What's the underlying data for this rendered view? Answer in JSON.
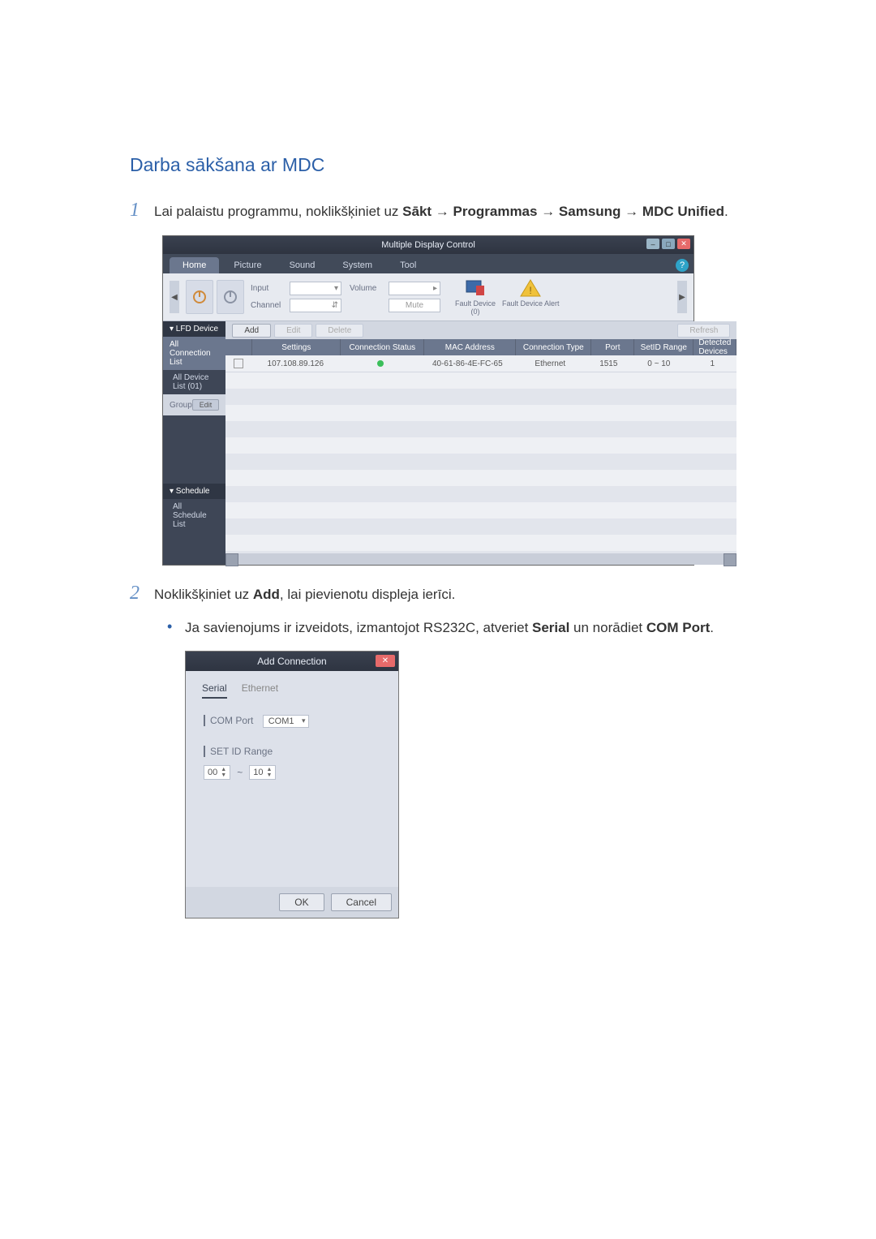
{
  "heading": "Darba sākšana ar MDC",
  "steps": {
    "s1_pre": "Lai palaistu programmu, noklikšķiniet uz ",
    "s1_path": [
      "Sākt",
      "Programmas",
      "Samsung",
      "MDC Unified"
    ],
    "s2_pre": "Noklikšķiniet uz ",
    "s2_bold": "Add",
    "s2_post": ", lai pievienotu displeja ierīci.",
    "bullet_pre": "Ja savienojums ir izveidots, izmantojot RS232C, atveriet ",
    "bullet_b1": "Serial",
    "bullet_mid": " un norādiet ",
    "bullet_b2": "COM Port",
    "bullet_post": "."
  },
  "mdc": {
    "title": "Multiple Display Control",
    "help": "?",
    "menu": [
      "Home",
      "Picture",
      "Sound",
      "System",
      "Tool"
    ],
    "fields": {
      "input": "Input",
      "channel": "Channel",
      "volume": "Volume",
      "mute": "Mute"
    },
    "fault": {
      "device": "Fault Device",
      "device_n": "(0)",
      "alert": "Fault Device Alert"
    },
    "side": {
      "lfd": "▾ LFD Device",
      "all": "All Connection List",
      "devlist": "All Device List (01)",
      "group": "Group",
      "edit": "Edit",
      "schedule": "▾ Schedule",
      "schedlist": "All Schedule List"
    },
    "actions": {
      "add": "Add",
      "edit": "Edit",
      "delete": "Delete",
      "refresh": "Refresh"
    },
    "thead": [
      "Settings",
      "Connection Status",
      "MAC Address",
      "Connection Type",
      "Port",
      "SetID Range",
      "Detected Devices"
    ],
    "row": {
      "ip": "107.108.89.126",
      "mac": "40-61-86-4E-FC-65",
      "type": "Ethernet",
      "port": "1515",
      "range": "0 ~ 10",
      "det": "1"
    }
  },
  "dlg": {
    "title": "Add Connection",
    "tabs": [
      "Serial",
      "Ethernet"
    ],
    "comport": "COM Port",
    "comval": "COM1",
    "range": "SET ID Range",
    "from": "00",
    "to": "10",
    "tilde": "~",
    "ok": "OK",
    "cancel": "Cancel"
  }
}
